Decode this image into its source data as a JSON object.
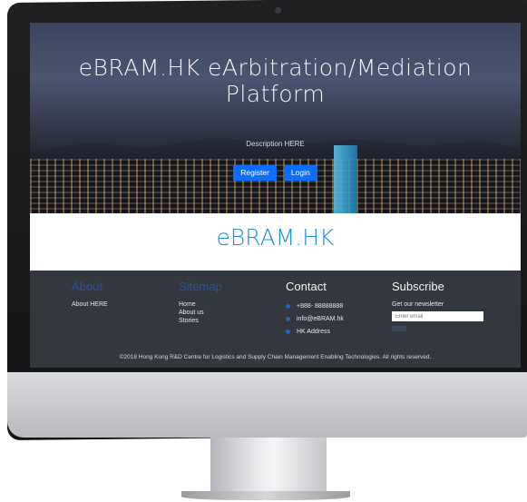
{
  "hero": {
    "title": "eBRAM.HK eArbitration/Mediation Platform",
    "description": "Description HERE",
    "buttons": [
      "Register",
      "Login"
    ]
  },
  "brand": {
    "title": "eBRAM.HK"
  },
  "footer": {
    "about": {
      "heading": "About",
      "text": "About HERE"
    },
    "sitemap": {
      "heading": "Sitemap",
      "links": [
        "Home",
        "About us",
        "Stories"
      ]
    },
    "contact": {
      "heading": "Contact",
      "items": [
        "+888- 88888888",
        "info@eBRAM.hk",
        "HK Address"
      ]
    },
    "subscribe": {
      "heading": "Subscribe",
      "text": "Get our newsletter",
      "placeholder": "Enter email"
    },
    "copyright": "©2018 Hong Kong R&D Centre for Logistics and Supply Chain Management Enabling Technologies. All rights reserved."
  },
  "colors": {
    "accent": "#0d6efd",
    "brand": "#1b8fd6",
    "footer_bg": "#33383e"
  }
}
